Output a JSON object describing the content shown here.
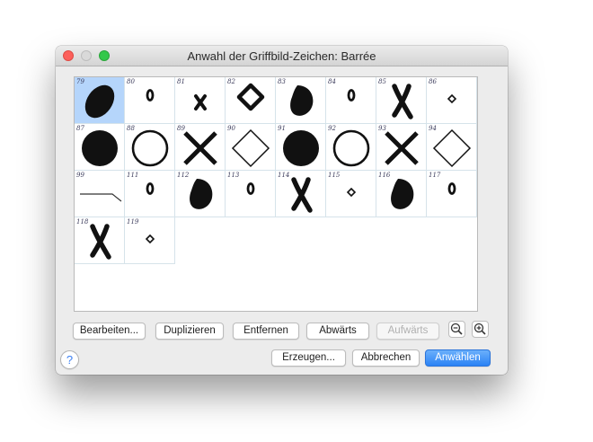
{
  "window": {
    "title": "Anwahl der Griffbild-Zeichen: Barrée"
  },
  "symbols": [
    {
      "num": "79",
      "shape": "thumb-blob",
      "selected": true
    },
    {
      "num": "80",
      "shape": "small-oval",
      "selected": false
    },
    {
      "num": "81",
      "shape": "small-x",
      "selected": false
    },
    {
      "num": "82",
      "shape": "open-diamond",
      "selected": false
    },
    {
      "num": "83",
      "shape": "blob",
      "selected": false
    },
    {
      "num": "84",
      "shape": "small-oval",
      "selected": false
    },
    {
      "num": "85",
      "shape": "brush-x",
      "selected": false
    },
    {
      "num": "86",
      "shape": "tiny-diamond",
      "selected": false
    },
    {
      "num": "87",
      "shape": "filled-circle",
      "selected": false
    },
    {
      "num": "88",
      "shape": "open-circle",
      "selected": false
    },
    {
      "num": "89",
      "shape": "big-x",
      "selected": false
    },
    {
      "num": "90",
      "shape": "outline-diamond",
      "selected": false
    },
    {
      "num": "91",
      "shape": "filled-circle",
      "selected": false
    },
    {
      "num": "92",
      "shape": "open-circle",
      "selected": false
    },
    {
      "num": "93",
      "shape": "big-x",
      "selected": false
    },
    {
      "num": "94",
      "shape": "outline-diamond",
      "selected": false
    },
    {
      "num": "99",
      "shape": "line",
      "selected": false
    },
    {
      "num": "111",
      "shape": "small-oval",
      "selected": false
    },
    {
      "num": "112",
      "shape": "blob",
      "selected": false
    },
    {
      "num": "113",
      "shape": "small-oval",
      "selected": false
    },
    {
      "num": "114",
      "shape": "brush-x",
      "selected": false
    },
    {
      "num": "115",
      "shape": "tiny-diamond",
      "selected": false
    },
    {
      "num": "116",
      "shape": "blob",
      "selected": false
    },
    {
      "num": "117",
      "shape": "small-oval",
      "selected": false
    },
    {
      "num": "118",
      "shape": "brush-x",
      "selected": false
    },
    {
      "num": "119",
      "shape": "tiny-diamond",
      "selected": false
    }
  ],
  "toolbar": {
    "edit_label": "Bearbeiten...",
    "duplicate_label": "Duplizieren",
    "remove_label": "Entfernen",
    "down_label": "Abwärts",
    "up_label": "Aufwärts",
    "zoom_out_icon": "zoom-out-icon",
    "zoom_in_icon": "zoom-in-icon"
  },
  "footer": {
    "help_label": "?",
    "create_label": "Erzeugen...",
    "cancel_label": "Abbrechen",
    "select_label": "Anwählen"
  },
  "colors": {
    "selection": "#b5d5fb",
    "primary_button": "#2b82f5",
    "close": "#fc605b",
    "maximize": "#34c84a"
  }
}
